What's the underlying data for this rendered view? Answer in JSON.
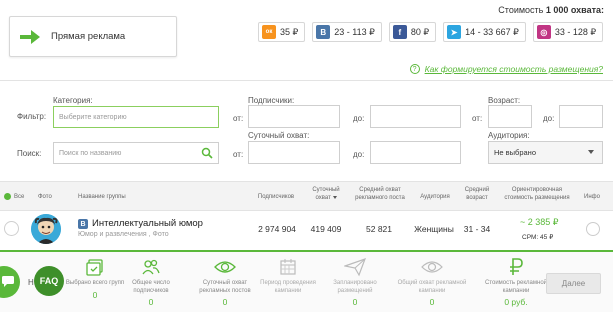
{
  "top": {
    "ad_button_label": "Прямая реклама",
    "cost_prefix": "Стоимость ",
    "cost_bold": "1 000 охвата:",
    "prices": [
      {
        "network": "odnoklassniki-icon",
        "color": "#f7931e",
        "value": "35 ₽"
      },
      {
        "network": "vk-icon",
        "color": "#4a76a8",
        "value": "23 - 113 ₽"
      },
      {
        "network": "facebook-icon",
        "color": "#3b5998",
        "value": "80 ₽"
      },
      {
        "network": "telegram-icon",
        "color": "#2ca5e0",
        "value": "14 - 33 667 ₽"
      },
      {
        "network": "instagram-icon",
        "color": "#c13584",
        "value": "33 - 128 ₽"
      }
    ],
    "how_link": "Как формируется стоимость размещения?"
  },
  "filter": {
    "filter_label": "Фильтр:",
    "search_label": "Поиск:",
    "category_label": "Категория:",
    "category_placeholder": "Выберите категорию",
    "search_placeholder": "Поиск по названию",
    "subscribers_label": "Подписчики:",
    "reach_label": "Суточный охват:",
    "from": "от:",
    "to": "до:",
    "age_label": "Возраст:",
    "audience_label": "Аудитория:",
    "audience_value": "Не выбрано"
  },
  "table": {
    "headers": {
      "all": "Все",
      "photo": "Фото",
      "name": "Название группы",
      "subscribers": "Подписчиков",
      "daily_reach": "Суточный охват",
      "avg_reach": "Средний охват рекламного поста",
      "audience": "Аудитория",
      "avg_age": "Средний возраст",
      "est_cost": "Ориентировочная стоимость размещения",
      "info": "Инфо"
    },
    "row": {
      "name": "Интеллектуальный юмор",
      "sub": "Юмор и развлечения , Фото",
      "subscribers": "2 974 904",
      "daily_reach": "419 409",
      "avg_reach": "52 821",
      "audience": "Женщины",
      "age": "31 - 34",
      "price": "~ 2 385 ₽",
      "cpm": "CPM: 45 ₽"
    }
  },
  "summary": {
    "faq": "FAQ",
    "faq_left": "Н",
    "stats": [
      {
        "icon": "groups-icon",
        "label": "Выбрано всего групп",
        "value": "0",
        "disabled": false
      },
      {
        "icon": "subscribers-icon",
        "label": "Общее число подписчиков",
        "value": "0",
        "disabled": false
      },
      {
        "icon": "eye-icon",
        "label": "Суточный охват рекламных постов",
        "value": "0",
        "disabled": false
      },
      {
        "icon": "calendar-icon",
        "label": "Период проведения кампании",
        "value": "",
        "disabled": true
      },
      {
        "icon": "send-icon",
        "label": "Запланировано размещений",
        "value": "0",
        "disabled": true
      },
      {
        "icon": "eye-outline-icon",
        "label": "Общий охват рекламной кампании",
        "value": "0",
        "disabled": true
      },
      {
        "icon": "ruble-icon",
        "label": "Стоимость рекламной кампании",
        "value": "0 руб.",
        "disabled": false
      }
    ],
    "next_button": "Далее"
  }
}
